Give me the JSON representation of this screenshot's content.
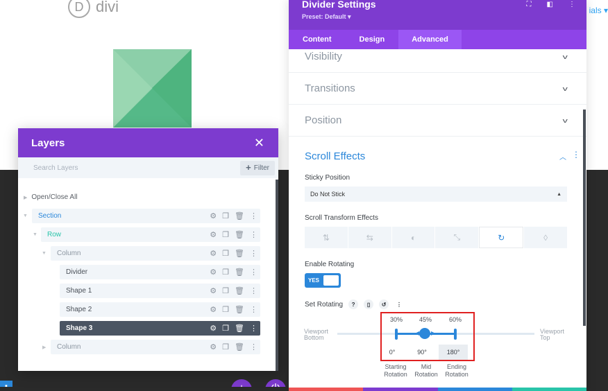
{
  "canvas": {
    "logo_letter": "D",
    "logo_text": "divi",
    "tutorials_link": "ials ▾"
  },
  "layers": {
    "title": "Layers",
    "search_placeholder": "Search Layers",
    "filter_label": "Filter",
    "open_close_all": "Open/Close All",
    "items": [
      {
        "label": "Section",
        "color": "#2b87da"
      },
      {
        "label": "Row",
        "color": "#29c4a9"
      },
      {
        "label": "Column",
        "color": "#8c96a1"
      },
      {
        "label": "Divider",
        "color": "#4a5058"
      },
      {
        "label": "Shape 1",
        "color": "#4a5058"
      },
      {
        "label": "Shape 2",
        "color": "#4a5058"
      },
      {
        "label": "Shape 3",
        "color": "#ffffff",
        "active": true
      },
      {
        "label": "Column",
        "color": "#8c96a1"
      }
    ]
  },
  "settings": {
    "title": "Divider Settings",
    "preset": "Preset: Default ▾",
    "tabs": [
      "Content",
      "Design",
      "Advanced"
    ],
    "active_tab": "Advanced",
    "sections": [
      "Visibility",
      "Transitions",
      "Position"
    ],
    "scroll_effects": {
      "title": "Scroll Effects",
      "sticky_label": "Sticky Position",
      "sticky_value": "Do Not Stick",
      "transform_label": "Scroll Transform Effects",
      "effect_icons": [
        "vertical-motion-icon",
        "horizontal-motion-icon",
        "fade-icon",
        "scale-icon",
        "rotate-icon",
        "blur-icon"
      ],
      "active_effect": "rotate-icon",
      "enable_label": "Enable Rotating",
      "toggle_value": "YES",
      "set_label": "Set Rotating",
      "viewport_bottom": "Viewport Bottom",
      "viewport_top": "Viewport Top",
      "start_pct": "30%",
      "mid_pct": "45%",
      "end_pct": "60%",
      "start_deg": "0°",
      "mid_deg": "90°",
      "end_deg": "180°",
      "start_label": "Starting Rotation",
      "mid_label": "Mid Rotation",
      "end_label": "Ending Rotation"
    }
  }
}
